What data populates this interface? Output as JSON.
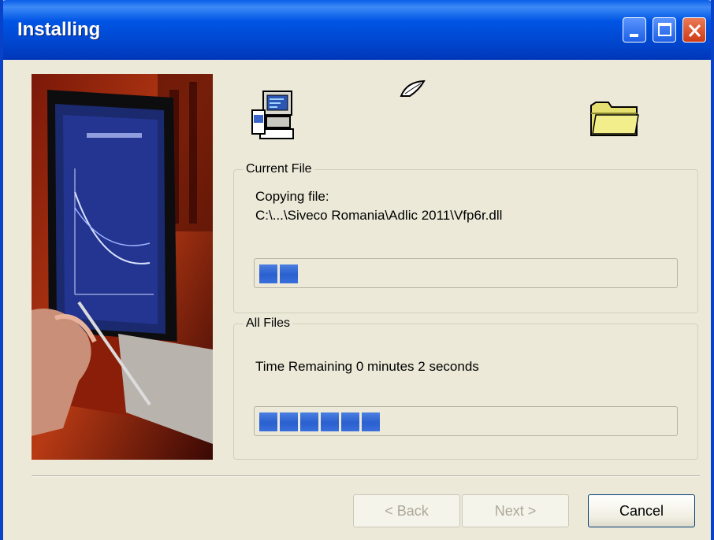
{
  "window": {
    "title": "Installing"
  },
  "current_file": {
    "legend": "Current File",
    "action": "Copying file:",
    "path": "C:\\...\\Siveco Romania\\Adlic 2011\\Vfp6r.dll",
    "progress": 0.14
  },
  "all_files": {
    "legend": "All Files",
    "status": "Time Remaining 0 minutes 2 seconds",
    "progress": 0.34
  },
  "buttons": {
    "back": "< Back",
    "next": "Next >",
    "cancel": "Cancel"
  },
  "icons": [
    "computer-setup-icon",
    "flying-paper-icon",
    "folder-icon"
  ],
  "colors": {
    "title_bar": "#0055e5",
    "progress_block": "#2a5fcf",
    "dialog_bg": "#ece9d8"
  }
}
